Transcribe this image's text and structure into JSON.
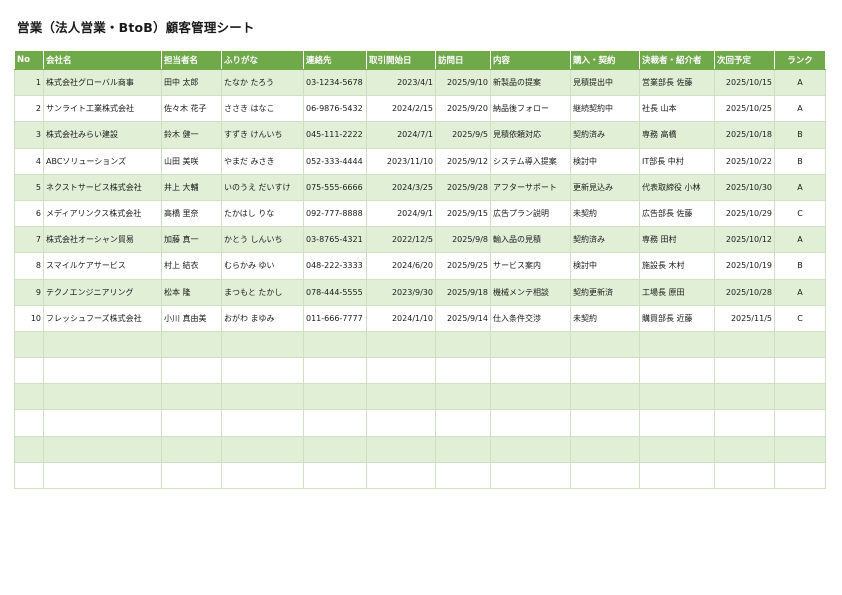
{
  "title": "営業（法人営業・BtoB）顧客管理シート",
  "columns": [
    "No",
    "会社名",
    "担当者名",
    "ふりがな",
    "連絡先",
    "取引開始日",
    "訪問日",
    "内容",
    "購入・契約",
    "決裁者・紹介者",
    "次回予定",
    "ランク"
  ],
  "rows": [
    [
      "1",
      "株式会社グローバル商事",
      "田中 太郎",
      "たなか たろう",
      "03-1234-5678",
      "2023/4/1",
      "2025/9/10",
      "新製品の提案",
      "見積提出中",
      "営業部長 佐藤",
      "2025/10/15",
      "A"
    ],
    [
      "2",
      "サンライト工業株式会社",
      "佐々木 花子",
      "ささき はなこ",
      "06-9876-5432",
      "2024/2/15",
      "2025/9/20",
      "納品後フォロー",
      "継続契約中",
      "社長 山本",
      "2025/10/25",
      "A"
    ],
    [
      "3",
      "株式会社みらい建設",
      "鈴木 健一",
      "すずき けんいち",
      "045-111-2222",
      "2024/7/1",
      "2025/9/5",
      "見積依頼対応",
      "契約済み",
      "専務 高橋",
      "2025/10/18",
      "B"
    ],
    [
      "4",
      "ABCソリューションズ",
      "山田 美咲",
      "やまだ みさき",
      "052-333-4444",
      "2023/11/10",
      "2025/9/12",
      "システム導入提案",
      "検討中",
      "IT部長 中村",
      "2025/10/22",
      "B"
    ],
    [
      "5",
      "ネクストサービス株式会社",
      "井上 大輔",
      "いのうえ だいすけ",
      "075-555-6666",
      "2024/3/25",
      "2025/9/28",
      "アフターサポート",
      "更新見込み",
      "代表取締役 小林",
      "2025/10/30",
      "A"
    ],
    [
      "6",
      "メディアリンクス株式会社",
      "高橋 里奈",
      "たかはし りな",
      "092-777-8888",
      "2024/9/1",
      "2025/9/15",
      "広告プラン説明",
      "未契約",
      "広告部長 佐藤",
      "2025/10/29",
      "C"
    ],
    [
      "7",
      "株式会社オーシャン貿易",
      "加藤 真一",
      "かとう しんいち",
      "03-8765-4321",
      "2022/12/5",
      "2025/9/8",
      "輸入品の見積",
      "契約済み",
      "専務 田村",
      "2025/10/12",
      "A"
    ],
    [
      "8",
      "スマイルケアサービス",
      "村上 結衣",
      "むらかみ ゆい",
      "048-222-3333",
      "2024/6/20",
      "2025/9/25",
      "サービス案内",
      "検討中",
      "施設長 木村",
      "2025/10/19",
      "B"
    ],
    [
      "9",
      "テクノエンジニアリング",
      "松本 隆",
      "まつもと たかし",
      "078-444-5555",
      "2023/9/30",
      "2025/9/18",
      "機械メンテ相談",
      "契約更新済",
      "工場長 原田",
      "2025/10/28",
      "A"
    ],
    [
      "10",
      "フレッシュフーズ株式会社",
      "小川 真由美",
      "おがわ まゆみ",
      "011-666-7777",
      "2024/1/10",
      "2025/9/14",
      "仕入条件交渉",
      "未契約",
      "購買部長 近藤",
      "2025/11/5",
      "C"
    ]
  ],
  "empty_rows": 6
}
